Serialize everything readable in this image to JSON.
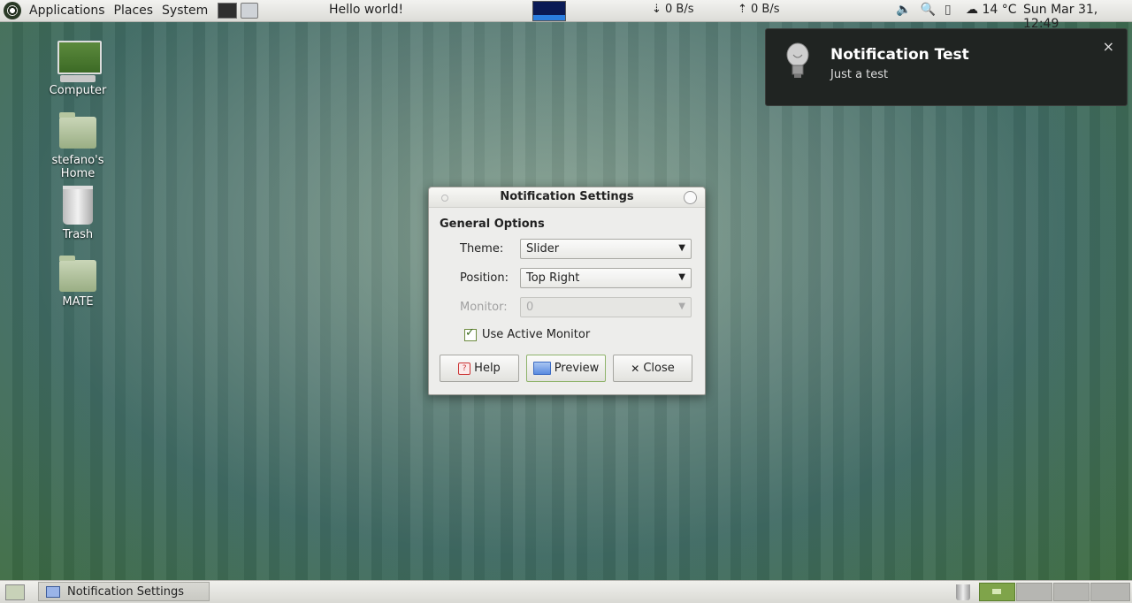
{
  "top_panel": {
    "menus": [
      "Applications",
      "Places",
      "System"
    ],
    "hello": "Hello world!",
    "net_down": "0 B/s",
    "net_up": "0 B/s",
    "temperature": "14 °C",
    "clock": "Sun Mar 31, 12:49"
  },
  "desktop_icons": [
    {
      "label": "Computer",
      "icon": "computer-icon"
    },
    {
      "label": "stefano's Home",
      "icon": "home-folder-icon"
    },
    {
      "label": "Trash",
      "icon": "trash-icon"
    },
    {
      "label": "MATE",
      "icon": "folder-icon"
    }
  ],
  "notification": {
    "title": "Notification Test",
    "body": "Just a test",
    "close_glyph": "×"
  },
  "dialog": {
    "title": "Notification Settings",
    "section": "General Options",
    "theme_label": "Theme:",
    "theme_value": "Slider",
    "position_label": "Position:",
    "position_value": "Top Right",
    "monitor_label": "Monitor:",
    "monitor_value": "0",
    "use_active_monitor_label": "Use Active Monitor",
    "use_active_monitor_checked": true,
    "help_label": "Help",
    "preview_label": "Preview",
    "close_label": "Close"
  },
  "bottom_panel": {
    "task_label": "Notification Settings",
    "workspaces": 4,
    "active_workspace": 1
  },
  "colors": {
    "accent": "#7fa44a",
    "notification_bg": "#202422"
  }
}
